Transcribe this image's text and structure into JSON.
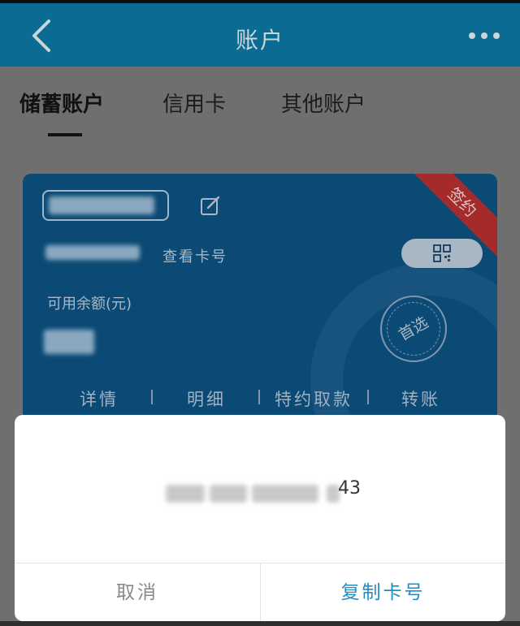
{
  "header": {
    "title": "账户",
    "back_icon": "chevron-left-icon",
    "more_icon": "more-dots-icon"
  },
  "tabs": [
    {
      "label": "储蓄账户",
      "active": true
    },
    {
      "label": "信用卡",
      "active": false
    },
    {
      "label": "其他账户",
      "active": false
    }
  ],
  "card": {
    "ribbon": "签约",
    "view_card_label": "查看卡号",
    "balance_label": "可用余额(元)",
    "preferred_badge": "首选",
    "actions": [
      "详情",
      "明细",
      "特约取款",
      "转账"
    ]
  },
  "dialog": {
    "number_tail": "43",
    "cancel_label": "取消",
    "copy_label": "复制卡号"
  },
  "colors": {
    "header": "#0b6c93",
    "card": "#0b4a75",
    "accent": "#1f8ec2",
    "ribbon": "#a52b2b"
  }
}
